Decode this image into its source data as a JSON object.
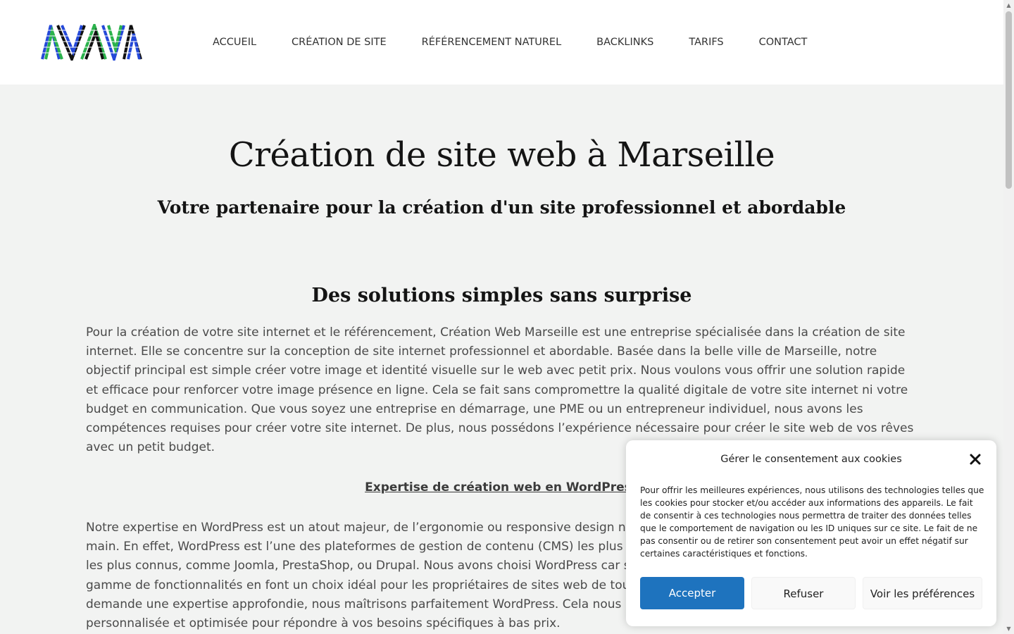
{
  "header": {
    "nav": [
      {
        "label": "ACCUEIL"
      },
      {
        "label": "CRÉATION DE SITE"
      },
      {
        "label": "RÉFÉRENCEMENT NATUREL"
      },
      {
        "label": "BACKLINKS"
      },
      {
        "label": "TARIFS"
      },
      {
        "label": "CONTACT"
      }
    ]
  },
  "hero": {
    "title": "Création de site web à Marseille",
    "subtitle": "Votre partenaire pour la création d'un site professionnel et abordable"
  },
  "section": {
    "title": "Des solutions simples sans surprise",
    "paragraph1": "Pour la création de votre site internet et le référencement, Création Web Marseille est une entreprise spécialisée dans la création de site internet. Elle se concentre sur la conception de site internet professionnel et abordable. Basée dans la belle ville de Marseille, notre objectif principal est simple créer votre image et identité visuelle sur le web avec petit prix. Nous voulons vous offrir une solution rapide et efficace pour renforcer votre image présence en ligne. Cela se fait sans compromettre la qualité digitale de votre site internet ni votre budget en communication. Que vous soyez une entreprise en démarrage, une PME ou un entrepreneur individuel, nous avons les compétences requises pour créer votre site internet. De plus, nous possédons l’expérience nécessaire pour créer le site web de vos rêves avec un petit budget.",
    "sublink": "Expertise de création web en WordPress",
    "paragraph2": "Notre expertise en WordPress est un atout majeur, de l’ergonomie ou responsive design nous vous proposons une solution digitale clé en main. En effet, WordPress est l’une des plateformes de gestion de contenu (CMS) les plus populaires au monde. Il en existe bien d’autre, les plus connus, comme Joomla, PrestaShop, ou Drupal. Nous avons choisi WordPress car sa facilité d’utilisation, sa flexibilité et sa vaste gamme de fonctionnalités en font un choix idéal pour les propriétaires de sites web de tous niveaux d’expertise. La création d’un site web demande une expertise approfondie, nous maîtrisons parfaitement WordPress. Cela nous permet de vous offrir une solution personnalisée et optimisée pour répondre à vos besoins spécifiques à bas prix."
  },
  "cookie": {
    "title": "Gérer le consentement aux cookies",
    "text": "Pour offrir les meilleures expériences, nous utilisons des technologies telles que les cookies pour stocker et/ou accéder aux informations des appareils. Le fait de consentir à ces technologies nous permettra de traiter des données telles que le comportement de navigation ou les ID uniques sur ce site. Le fait de ne pas consentir ou de retirer son consentement peut avoir un effet négatif sur certaines caractéristiques et fonctions.",
    "accept": "Accepter",
    "refuse": "Refuser",
    "preferences": "Voir les préférences"
  },
  "colors": {
    "accent": "#1e73be",
    "background": "#f2f3f2",
    "logo_green": "#2bb24c",
    "logo_blue": "#2448d8"
  },
  "icons": {
    "logo": "logo-mark",
    "close": "close-icon"
  }
}
